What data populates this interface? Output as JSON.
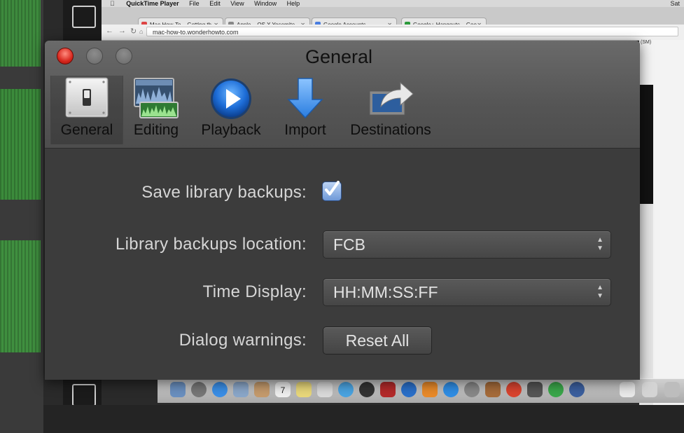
{
  "menubar": {
    "app_name": "QuickTime Player",
    "items": [
      "File",
      "Edit",
      "View",
      "Window",
      "Help"
    ],
    "clock": "Sat"
  },
  "browser": {
    "tabs": [
      {
        "label": "Mac How-To – Getting th...",
        "favicon_color": "#d44"
      },
      {
        "label": "Apple – OS X Yosemite – ...",
        "favicon_color": "#888"
      },
      {
        "label": "Google Accounts",
        "favicon_color": "#4a7ee0"
      },
      {
        "label": "Google+ Hangouts – Goo...",
        "favicon_color": "#2c9a3c"
      }
    ],
    "url": "mac-how-to.wonderhowto.com",
    "side_text": "(SM)"
  },
  "window": {
    "title": "General",
    "toolbar": [
      {
        "label": "General",
        "icon": "toggle-switch-icon",
        "selected": true
      },
      {
        "label": "Editing",
        "icon": "waveform-icon",
        "selected": false
      },
      {
        "label": "Playback",
        "icon": "play-icon",
        "selected": false
      },
      {
        "label": "Import",
        "icon": "import-arrow-icon",
        "selected": false
      },
      {
        "label": "Destinations",
        "icon": "share-arrow-icon",
        "selected": false
      }
    ],
    "settings": {
      "backups_label": "Save library backups:",
      "backups_checked": true,
      "location_label": "Library backups location:",
      "location_value": "FCB",
      "time_label": "Time Display:",
      "time_value": "HH:MM:SS:FF",
      "warnings_label": "Dialog warnings:",
      "reset_label": "Reset All"
    }
  },
  "dock": {
    "calendar_day": "7"
  }
}
